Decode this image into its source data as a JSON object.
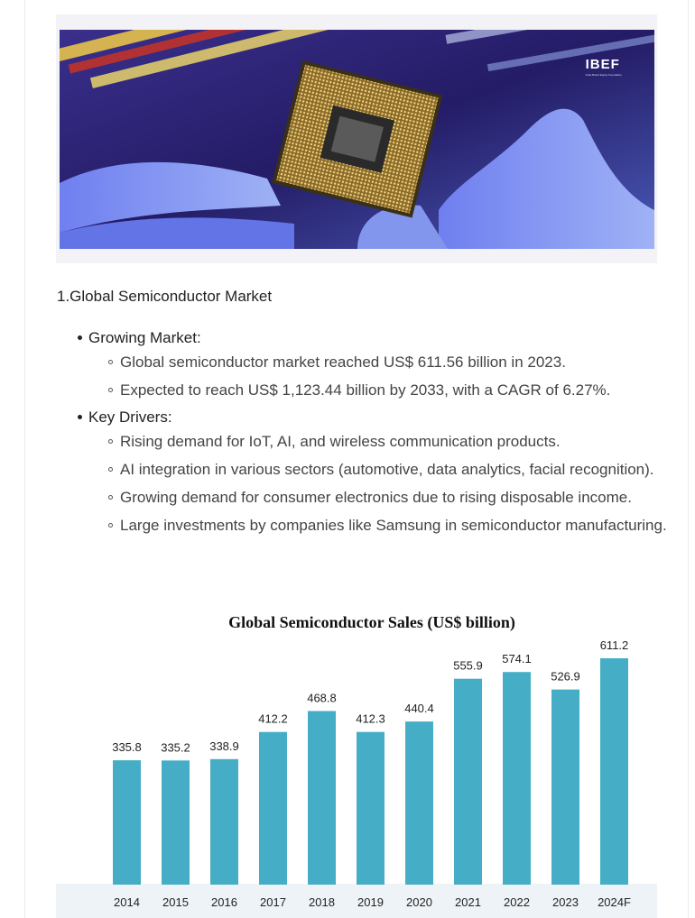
{
  "hero": {
    "logo_text": "IBEF",
    "logo_tagline": "India Brand Equity Foundation"
  },
  "section_title": "1.Global Semiconductor Market",
  "bullets": [
    {
      "label": "Growing Market:",
      "items": [
        "Global semiconductor market reached US$ 611.56 billion in 2023.",
        "Expected to reach US$ 1,123.44 billion by 2033, with a CAGR of 6.27%."
      ]
    },
    {
      "label": "Key Drivers:",
      "items": [
        "Rising demand for IoT, AI, and wireless communication products.",
        "AI integration in various sectors (automotive, data analytics, facial recognition).",
        "Growing demand for consumer electronics due to rising disposable income.",
        "Large investments by companies like Samsung in semiconductor manufacturing."
      ]
    }
  ],
  "chart_data": {
    "type": "bar",
    "title": "Global Semiconductor Sales (US$ billion)",
    "categories": [
      "2014",
      "2015",
      "2016",
      "2017",
      "2018",
      "2019",
      "2020",
      "2021",
      "2022",
      "2023",
      "2024F"
    ],
    "values": [
      335.8,
      335.2,
      338.9,
      412.2,
      468.8,
      412.3,
      440.4,
      555.9,
      574.1,
      526.9,
      611.2
    ],
    "value_labels": [
      "335.8",
      "335.2",
      "338.9",
      "412.2",
      "468.8",
      "412.3",
      "440.4",
      "555.9",
      "574.1",
      "526.9",
      "611.2"
    ],
    "xlabel": "",
    "ylabel": "",
    "bar_color": "#45aec6",
    "grid": false
  }
}
